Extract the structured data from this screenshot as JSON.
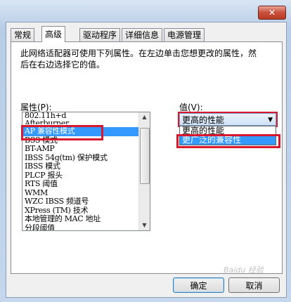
{
  "window": {
    "close_glyph": "✕"
  },
  "tabs": [
    {
      "label": "常规"
    },
    {
      "label": "高级"
    },
    {
      "label": "驱动程序"
    },
    {
      "label": "详细信息"
    },
    {
      "label": "电源管理"
    }
  ],
  "description": "此网络适配器可使用下列属性。在左边单击您想更改的属性，然后在右边选择它的值。",
  "property_label": "属性(P):",
  "value_label": "值(V):",
  "properties": [
    "802.11h+d",
    "Afterburner",
    "AP 兼容性模式",
    "BSS 模式",
    "BT-AMP",
    "IBSS 54g(tm) 保护模式",
    "IBSS 模式",
    "PLCP 报头",
    "RTS 阈值",
    "WMM",
    "WZC IBSS 频道号",
    "XPress (TM) 技术",
    "本地管理的 MAC 地址",
    "分段阈值"
  ],
  "value": {
    "selected": "更高的性能",
    "options": [
      "更高的性能",
      "更广泛的兼容性"
    ]
  },
  "buttons": {
    "ok": "确定",
    "cancel": "取消"
  },
  "watermark": "Baidu 经验",
  "colors": {
    "highlight": "#d8182c",
    "selection": "#3399ff"
  }
}
